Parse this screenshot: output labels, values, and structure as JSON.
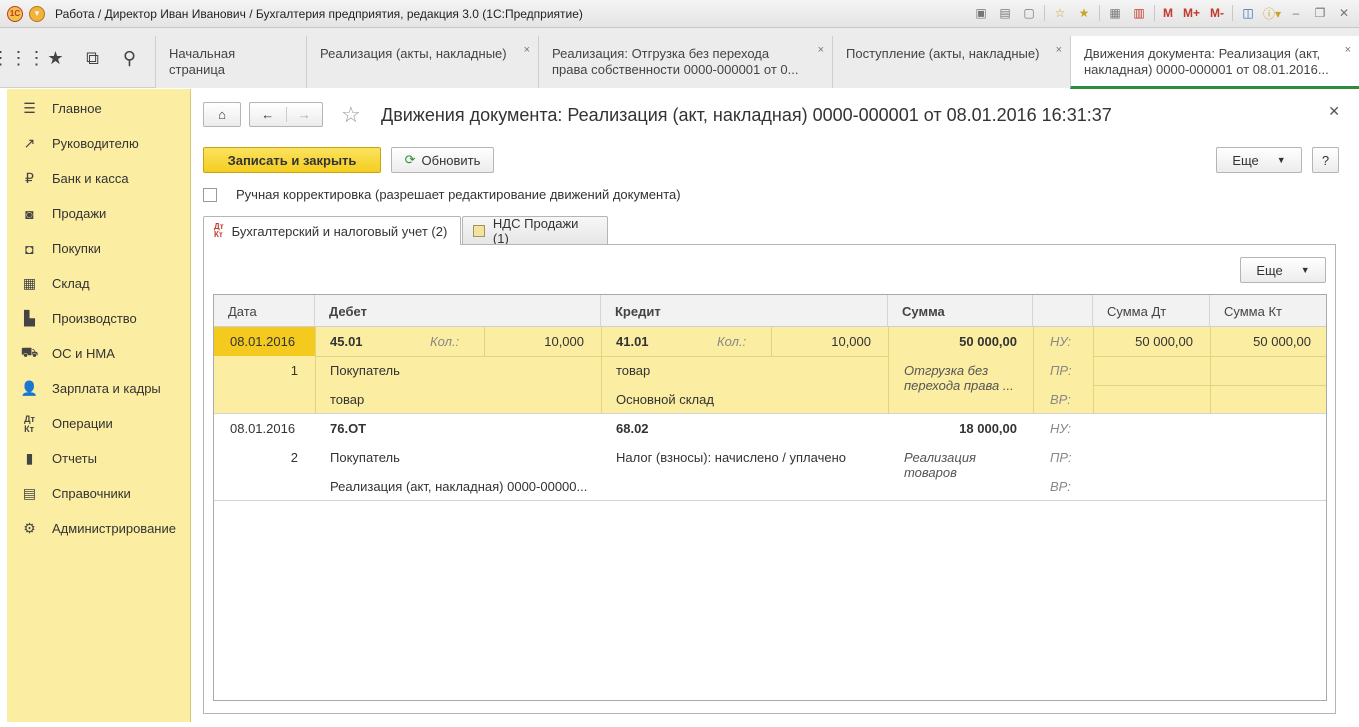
{
  "window": {
    "title": "Работа / Директор Иван Иванович / Бухгалтерия предприятия, редакция 3.0  (1С:Предприятие)",
    "tools": [
      "М",
      "М+",
      "М-"
    ]
  },
  "tabs": [
    {
      "label": "Начальная страница"
    },
    {
      "label": "Реализация (акты, накладные)"
    },
    {
      "label": "Реализация: Отгрузка без перехода права собственности 0000-000001 от 0..."
    },
    {
      "label": "Поступление (акты, накладные)"
    },
    {
      "label": "Движения документа: Реализация (акт, накладная) 0000-000001 от 08.01.2016..."
    }
  ],
  "sidebar": {
    "items": [
      {
        "label": "Главное",
        "icon": "menu-icon"
      },
      {
        "label": "Руководителю",
        "icon": "chart-trend-icon"
      },
      {
        "label": "Банк и касса",
        "icon": "ruble-icon"
      },
      {
        "label": "Продажи",
        "icon": "bag-icon"
      },
      {
        "label": "Покупки",
        "icon": "cart-icon"
      },
      {
        "label": "Склад",
        "icon": "warehouse-icon"
      },
      {
        "label": "Производство",
        "icon": "factory-icon"
      },
      {
        "label": "ОС и НМА",
        "icon": "truck-icon"
      },
      {
        "label": "Зарплата и кадры",
        "icon": "people-icon"
      },
      {
        "label": "Операции",
        "icon": "dt-kt-icon"
      },
      {
        "label": "Отчеты",
        "icon": "bar-chart-icon"
      },
      {
        "label": "Справочники",
        "icon": "books-icon"
      },
      {
        "label": "Администрирование",
        "icon": "gear-icon"
      }
    ]
  },
  "form": {
    "title": "Движения документа: Реализация (акт, накладная) 0000-000001 от 08.01.2016 16:31:37",
    "save_label": "Записать и закрыть",
    "refresh_label": "Обновить",
    "more_label": "Еще",
    "help_label": "?",
    "manual_label": "Ручная корректировка (разрешает редактирование движений документа)",
    "tab1": "Бухгалтерский и налоговый учет (2)",
    "tab2": "НДС Продажи (1)",
    "tab_icon_dt": "Дт",
    "tab_icon_kt": "Кт"
  },
  "table": {
    "headers": [
      "Дата",
      "Дебет",
      "Кредит",
      "Сумма",
      "",
      "Сумма Дт",
      "Сумма Кт"
    ],
    "qty_label": "Кол.:",
    "rows": [
      {
        "date": "08.01.2016",
        "num": "1",
        "debit": "45.01",
        "debit_qty": "10,000",
        "debit_sub1": "Покупатель",
        "debit_sub2": "товар",
        "credit": "41.01",
        "credit_qty": "10,000",
        "credit_sub1": "товар",
        "credit_sub2": "Основной склад",
        "sum": "50 000,00",
        "content": "Отгрузка без перехода права ...",
        "nu": "НУ:",
        "pr": "ПР:",
        "vr": "ВР:",
        "sum_dt": "50 000,00",
        "sum_kt": "50 000,00"
      },
      {
        "date": "08.01.2016",
        "num": "2",
        "debit": "76.ОТ",
        "debit_sub1": "Покупатель",
        "debit_sub2": "Реализация (акт, накладная) 0000-00000...",
        "credit": "68.02",
        "credit_sub1": "Налог (взносы): начислено / уплачено",
        "sum": "18 000,00",
        "content": "Реализация товаров",
        "nu": "НУ:",
        "pr": "ПР:",
        "vr": "ВР:"
      }
    ]
  }
}
